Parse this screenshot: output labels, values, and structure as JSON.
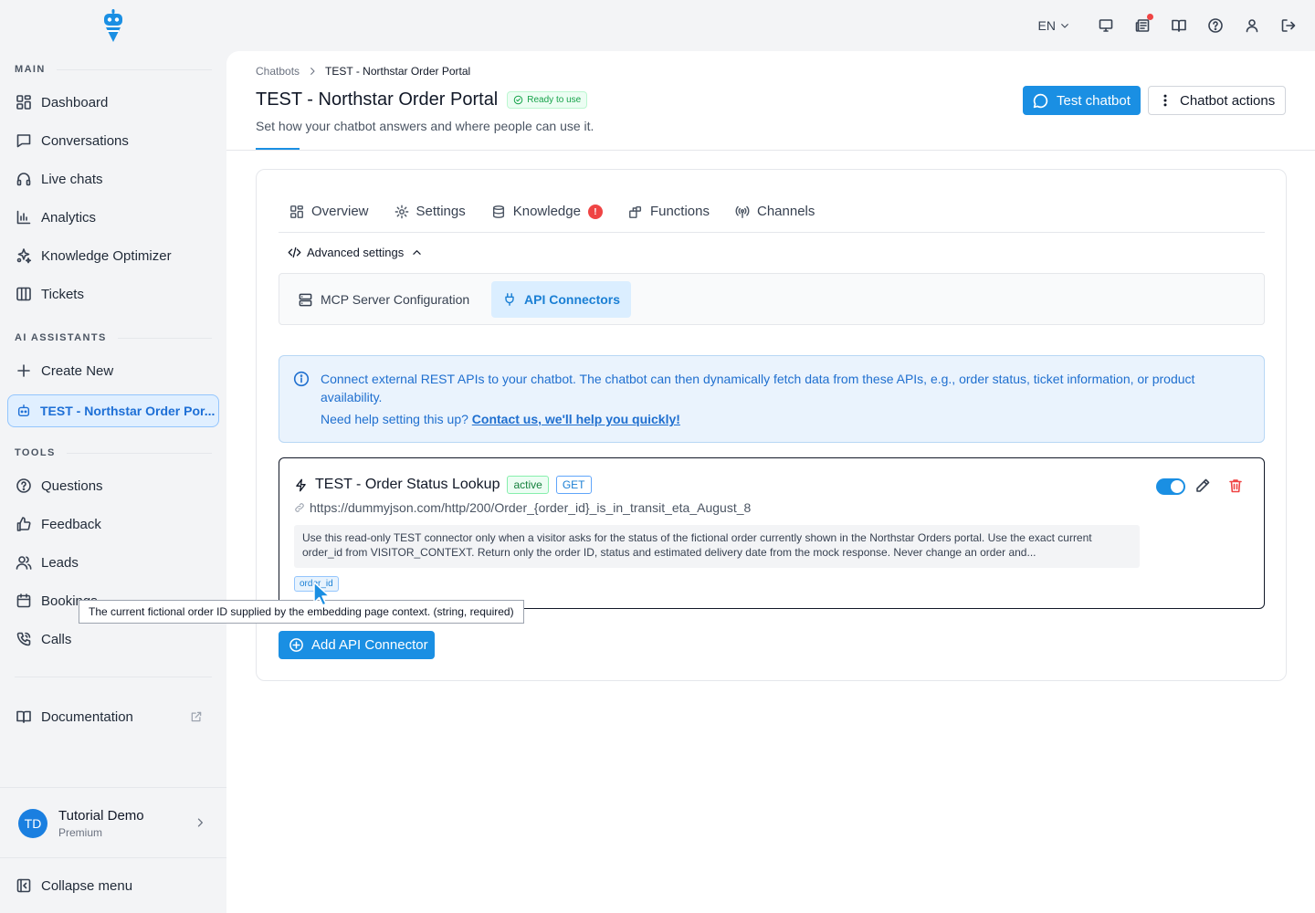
{
  "topbar": {
    "language": "EN",
    "icons": [
      "monitor-icon",
      "news-icon",
      "book-open-icon",
      "help-circle-icon",
      "user-icon",
      "logout-icon"
    ]
  },
  "sidebar": {
    "main_label": "MAIN",
    "main_items": [
      {
        "label": "Dashboard",
        "icon": "dashboard-icon"
      },
      {
        "label": "Conversations",
        "icon": "chat-icon"
      },
      {
        "label": "Live chats",
        "icon": "headset-icon"
      },
      {
        "label": "Analytics",
        "icon": "chart-icon"
      },
      {
        "label": "Knowledge Optimizer",
        "icon": "sparkles-icon"
      },
      {
        "label": "Tickets",
        "icon": "columns-icon"
      }
    ],
    "ai_label": "AI ASSISTANTS",
    "create_new": "Create New",
    "active_assistant": "TEST - Northstar Order Por...",
    "tools_label": "TOOLS",
    "tools_items": [
      {
        "label": "Questions",
        "icon": "help-circle-icon"
      },
      {
        "label": "Feedback",
        "icon": "thumbs-up-icon"
      },
      {
        "label": "Leads",
        "icon": "users-icon"
      },
      {
        "label": "Bookings",
        "icon": "calendar-icon"
      },
      {
        "label": "Calls",
        "icon": "phone-icon"
      }
    ],
    "documentation": "Documentation",
    "user": {
      "initials": "TD",
      "name": "Tutorial Demo",
      "plan": "Premium"
    },
    "collapse": "Collapse menu"
  },
  "header": {
    "breadcrumb_root": "Chatbots",
    "breadcrumb_current": "TEST - Northstar Order Portal",
    "title": "TEST - Northstar Order Portal",
    "status": "Ready to use",
    "subtitle": "Set how your chatbot answers and where people can use it.",
    "test_button": "Test chatbot",
    "actions_button": "Chatbot actions"
  },
  "tabs": [
    {
      "label": "Overview"
    },
    {
      "label": "Settings"
    },
    {
      "label": "Knowledge",
      "badge": "!"
    },
    {
      "label": "Functions"
    },
    {
      "label": "Channels"
    }
  ],
  "advanced_settings": "Advanced settings",
  "subtabs": {
    "mcp": "MCP Server Configuration",
    "api": "API Connectors"
  },
  "info": {
    "text": "Connect external REST APIs to your chatbot. The chatbot can then dynamically fetch data from these APIs, e.g., order status, ticket information, or product availability.",
    "help_prefix": "Need help setting this up?",
    "help_link": "Contact us, we'll help you quickly!"
  },
  "connector": {
    "name": "TEST - Order Status Lookup",
    "status": "active",
    "method": "GET",
    "url": "https://dummyjson.com/http/200/Order_{order_id}_is_in_transit_eta_August_8",
    "description": "Use this read-only TEST connector only when a visitor asks for the status of the fictional order currently shown in the Northstar Orders portal. Use the exact current order_id from VISITOR_CONTEXT. Return only the order ID, status and estimated delivery date from the mock response. Never change an order and...",
    "param": "order_id",
    "enabled": true
  },
  "tooltip": "The current fictional order ID supplied by the embedding page context. (string, required)",
  "add_button": "Add API Connector",
  "colors": {
    "accent": "#1a8fe3",
    "danger": "#ef4444",
    "success": "#16a34a"
  }
}
